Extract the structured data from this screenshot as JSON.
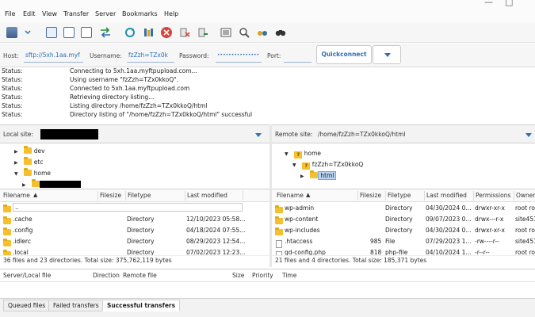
{
  "menu": [
    "File",
    "Edit",
    "View",
    "Transfer",
    "Server",
    "Bookmarks",
    "Help"
  ],
  "window_controls": {
    "minimize": "—",
    "maximize": "□"
  },
  "toolbar": {
    "icons": [
      "site-manager-icon",
      "site-dropdown-icon",
      "toggle-log-icon",
      "toggle-local-tree-icon",
      "toggle-remote-tree-icon",
      "toggle-queue-icon",
      "refresh-icon",
      "process-queue-icon",
      "cancel-icon",
      "disconnect-icon",
      "reconnect-icon",
      "filter-icon",
      "compare-icon",
      "sync-browse-icon",
      "search-icon"
    ]
  },
  "quickconnect": {
    "host_label": "Host:",
    "host_value": "sftp://5xh.1aa.myf",
    "username_label": "Username:",
    "username_value": "fzZzh=TZx0k",
    "password_label": "Password:",
    "password_value": "•••••••••••••••",
    "port_label": "Port:",
    "port_value": "",
    "button_label": "Quickconnect"
  },
  "log": [
    {
      "status": "Status:",
      "message": "Connecting to 5xh.1aa.myftpupload.com..."
    },
    {
      "status": "Status:",
      "message": "Using username \"fzZzh=TZx0kkoQ\"."
    },
    {
      "status": "Status:",
      "message": "Connected to 5xh.1aa.myftpupload.com"
    },
    {
      "status": "Status:",
      "message": "Retrieving directory listing..."
    },
    {
      "status": "Status:",
      "message": "Listing directory /home/fzZzh=TZx0kkoQ/html"
    },
    {
      "status": "Status:",
      "message": "Directory listing of \"/home/fzZzh=TZx0kkoQ/html\" successful"
    }
  ],
  "local": {
    "site_label": "Local site:",
    "tree": [
      {
        "name": "dev"
      },
      {
        "name": "etc"
      },
      {
        "name": "home"
      }
    ],
    "columns": {
      "filename": "Filename",
      "filesize": "Filesize",
      "filetype": "Filetype",
      "modified": "Last modified"
    },
    "files": [
      {
        "name": "..",
        "type": "",
        "modified": ""
      },
      {
        "name": ".cache",
        "type": "Directory",
        "modified": "12/10/2023 05:58..."
      },
      {
        "name": ".config",
        "type": "Directory",
        "modified": "04/18/2024 07:55..."
      },
      {
        "name": ".idlerc",
        "type": "Directory",
        "modified": "08/29/2023 12:54..."
      },
      {
        "name": ".local",
        "type": "Directory",
        "modified": "07/02/2023 12:23..."
      }
    ],
    "status": "36 files and 23 directories. Total size: 375,762,119 bytes"
  },
  "remote": {
    "site_label": "Remote site:",
    "path": "/home/fzZzh=TZx0kkoQ/html",
    "tree": [
      {
        "name": "home"
      },
      {
        "name": "fzZzh=TZx0kkoQ"
      },
      {
        "name": "html"
      }
    ],
    "columns": {
      "filename": "Filename",
      "filesize": "Filesize",
      "filetype": "Filetype",
      "modified": "Last modified",
      "permissions": "Permissions",
      "owner": "Owner"
    },
    "files": [
      {
        "name": "wp-admin",
        "size": "",
        "type": "Directory",
        "modified": "04/30/2024 0...",
        "permissions": "drwxr-xr-x",
        "owner": "root ro"
      },
      {
        "name": "wp-content",
        "size": "",
        "type": "Directory",
        "modified": "09/07/2023 0...",
        "permissions": "drwx---r-x",
        "owner": "site451"
      },
      {
        "name": "wp-includes",
        "size": "",
        "type": "Directory",
        "modified": "04/30/2024 0...",
        "permissions": "drwxr-xr-x",
        "owner": "root ro"
      },
      {
        "name": ".htaccess",
        "size": "985",
        "type": "File",
        "modified": "07/29/2023 1...",
        "permissions": "-rw----r--",
        "owner": "site451"
      },
      {
        "name": "gd-config.php",
        "size": "818",
        "type": "php-file",
        "modified": "04/10/2024 1...",
        "permissions": "-r--r--",
        "owner": "root ro"
      }
    ],
    "status": "21 files and 4 directories. Total size: 185,371 bytes"
  },
  "queue": {
    "columns": {
      "server_local": "Server/Local file",
      "direction": "Direction",
      "remote_file": "Remote file",
      "size": "Size",
      "priority": "Priority",
      "time": "Time"
    },
    "tabs": [
      "Queued files",
      "Failed transfers",
      "Successful transfers"
    ]
  },
  "colors": {
    "accent": "#2f6fb5",
    "folder": "#f5c02e",
    "selection": "#b9d3f0"
  }
}
